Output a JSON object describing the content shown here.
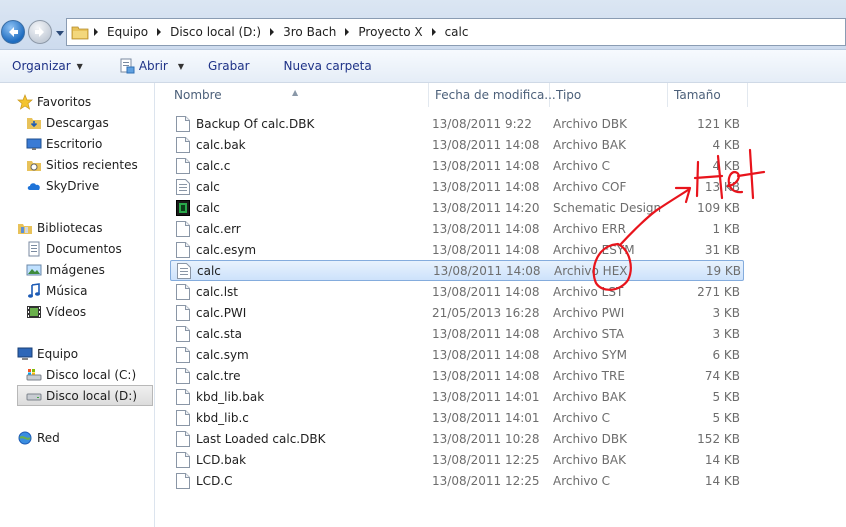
{
  "address": {
    "crumbs": [
      "Equipo",
      "Disco local (D:)",
      "3ro Bach",
      "Proyecto X",
      "calc"
    ]
  },
  "commands": {
    "organize": "Organizar",
    "open": "Abrir",
    "burn": "Grabar",
    "new_folder": "Nueva carpeta"
  },
  "nav": {
    "favorites": "Favoritos",
    "downloads": "Descargas",
    "desktop": "Escritorio",
    "recent": "Sitios recientes",
    "skydrive": "SkyDrive",
    "libraries": "Bibliotecas",
    "documents": "Documentos",
    "images": "Imágenes",
    "music": "Música",
    "videos": "Vídeos",
    "computer": "Equipo",
    "drive_c": "Disco local (C:)",
    "drive_d": "Disco local (D:)",
    "network": "Red"
  },
  "columns": {
    "name": "Nombre",
    "date": "Fecha de modifica...",
    "type": "Tipo",
    "size": "Tamaño"
  },
  "files": [
    {
      "name": "Backup Of calc.DBK",
      "date": "13/08/2011 9:22",
      "type": "Archivo DBK",
      "size": "121 KB",
      "icon": "document-icon"
    },
    {
      "name": "calc.bak",
      "date": "13/08/2011 14:08",
      "type": "Archivo BAK",
      "size": "4 KB",
      "icon": "document-icon"
    },
    {
      "name": "calc.c",
      "date": "13/08/2011 14:08",
      "type": "Archivo C",
      "size": "4 KB",
      "icon": "document-icon"
    },
    {
      "name": "calc",
      "date": "13/08/2011 14:08",
      "type": "Archivo COF",
      "size": "13 KB",
      "icon": "text-file-icon"
    },
    {
      "name": "calc",
      "date": "13/08/2011 14:20",
      "type": "Schematic Design",
      "size": "109 KB",
      "icon": "schematic-icon"
    },
    {
      "name": "calc.err",
      "date": "13/08/2011 14:08",
      "type": "Archivo ERR",
      "size": "1 KB",
      "icon": "document-icon"
    },
    {
      "name": "calc.esym",
      "date": "13/08/2011 14:08",
      "type": "Archivo ESYM",
      "size": "31 KB",
      "icon": "document-icon"
    },
    {
      "name": "calc",
      "date": "13/08/2011 14:08",
      "type": "Archivo HEX",
      "size": "19 KB",
      "icon": "text-file-icon"
    },
    {
      "name": "calc.lst",
      "date": "13/08/2011 14:08",
      "type": "Archivo LST",
      "size": "271 KB",
      "icon": "document-icon"
    },
    {
      "name": "calc.PWI",
      "date": "21/05/2013 16:28",
      "type": "Archivo PWI",
      "size": "3 KB",
      "icon": "document-icon"
    },
    {
      "name": "calc.sta",
      "date": "13/08/2011 14:08",
      "type": "Archivo STA",
      "size": "3 KB",
      "icon": "document-icon"
    },
    {
      "name": "calc.sym",
      "date": "13/08/2011 14:08",
      "type": "Archivo SYM",
      "size": "6 KB",
      "icon": "document-icon"
    },
    {
      "name": "calc.tre",
      "date": "13/08/2011 14:08",
      "type": "Archivo TRE",
      "size": "74 KB",
      "icon": "document-icon"
    },
    {
      "name": "kbd_lib.bak",
      "date": "13/08/2011 14:01",
      "type": "Archivo BAK",
      "size": "5 KB",
      "icon": "document-icon"
    },
    {
      "name": "kbd_lib.c",
      "date": "13/08/2011 14:01",
      "type": "Archivo C",
      "size": "5 KB",
      "icon": "document-icon"
    },
    {
      "name": "Last Loaded calc.DBK",
      "date": "13/08/2011 10:28",
      "type": "Archivo DBK",
      "size": "152 KB",
      "icon": "document-icon"
    },
    {
      "name": "LCD.bak",
      "date": "13/08/2011 12:25",
      "type": "Archivo BAK",
      "size": "14 KB",
      "icon": "document-icon"
    },
    {
      "name": "LCD.C",
      "date": "13/08/2011 12:25",
      "type": "Archivo C",
      "size": "14 KB",
      "icon": "document-icon"
    }
  ],
  "selected_index": 7,
  "annotation": {
    "text": "Hex",
    "color": "#e8141c"
  }
}
